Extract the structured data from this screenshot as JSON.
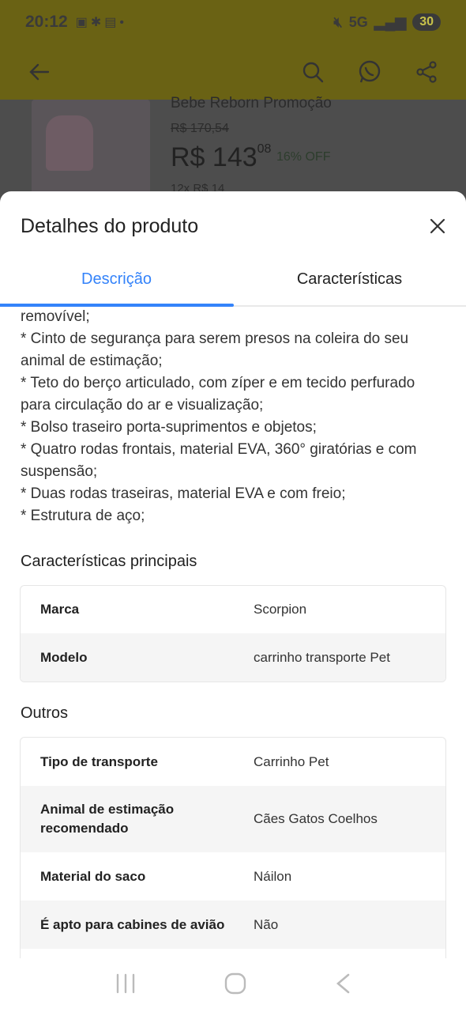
{
  "status_bar": {
    "time": "20:12",
    "network": "5G",
    "battery": "30"
  },
  "background_product": {
    "title": "Bebe Reborn Promoção",
    "old_price": "R$ 170,54",
    "price_main": "R$ 143",
    "price_cents": "08",
    "discount": "16% OFF",
    "installments": "12x R$ 14"
  },
  "sheet": {
    "title": "Detalhes do produto",
    "tabs": [
      {
        "label": "Descrição",
        "active": true
      },
      {
        "label": "Características",
        "active": false
      }
    ],
    "description_lines": [
      "removível;",
      "* Cinto de segurança para serem presos na coleira do seu animal de estimação;",
      "* Teto do berço articulado, com zíper e em tecido perfurado para circulação do ar e visualização;",
      "* Bolso traseiro porta-suprimentos e objetos;",
      "* Quatro rodas frontais, material EVA, 360° giratórias e com suspensão;",
      "* Duas rodas traseiras, material EVA e com freio;",
      "* Estrutura de aço;"
    ],
    "main_specs": {
      "title": "Características principais",
      "rows": [
        {
          "key": "Marca",
          "value": "Scorpion"
        },
        {
          "key": "Modelo",
          "value": "carrinho transporte Pet"
        }
      ]
    },
    "other_specs": {
      "title": "Outros",
      "rows": [
        {
          "key": "Tipo de transporte",
          "value": "Carrinho Pet"
        },
        {
          "key": "Animal de estimação recomendado",
          "value": "Cães Gatos Coelhos"
        },
        {
          "key": "Material do saco",
          "value": "Náilon"
        },
        {
          "key": "É apto para cabines de avião",
          "value": "Não"
        }
      ]
    }
  },
  "colors": {
    "accent": "#3483fa",
    "app_bar_dimmed": "#6a6214"
  }
}
